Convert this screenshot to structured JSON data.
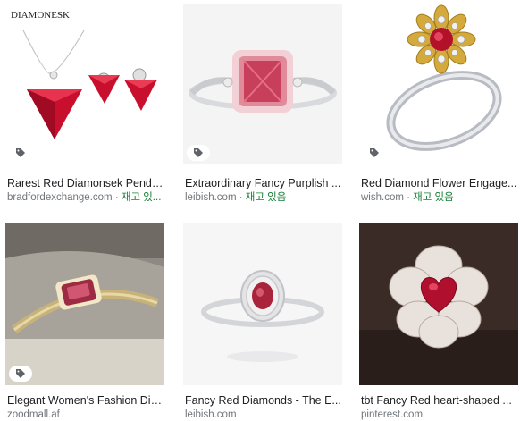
{
  "results": [
    {
      "title": "Rarest Red Diamonsek Penda...",
      "source": "bradfordexchange.com",
      "separator": " · ",
      "stock": "재고 있...",
      "logo_text": "DIAMONESK",
      "tag_icon": "tag-icon"
    },
    {
      "title": "Extraordinary Fancy Purplish ...",
      "source": "leibish.com",
      "separator": " · ",
      "stock": "재고 있음",
      "tag_icon": "tag-icon"
    },
    {
      "title": "Red Diamond Flower Engage...",
      "source": "wish.com",
      "separator": " · ",
      "stock": "재고 있음",
      "tag_icon": "tag-icon"
    },
    {
      "title": "Elegant Women's Fashion Dia...",
      "source": "zoodmall.af",
      "separator": "",
      "stock": "",
      "tag_icon": "tag-icon"
    },
    {
      "title": "Fancy Red Diamonds - The E...",
      "source": "leibish.com",
      "separator": "",
      "stock": ""
    },
    {
      "title": "tbt Fancy Red heart-shaped ...",
      "source": "pinterest.com",
      "separator": "",
      "stock": ""
    }
  ],
  "colors": {
    "stock_green": "#188038",
    "meta_grey": "#70757a",
    "ruby": "#c8102e"
  }
}
